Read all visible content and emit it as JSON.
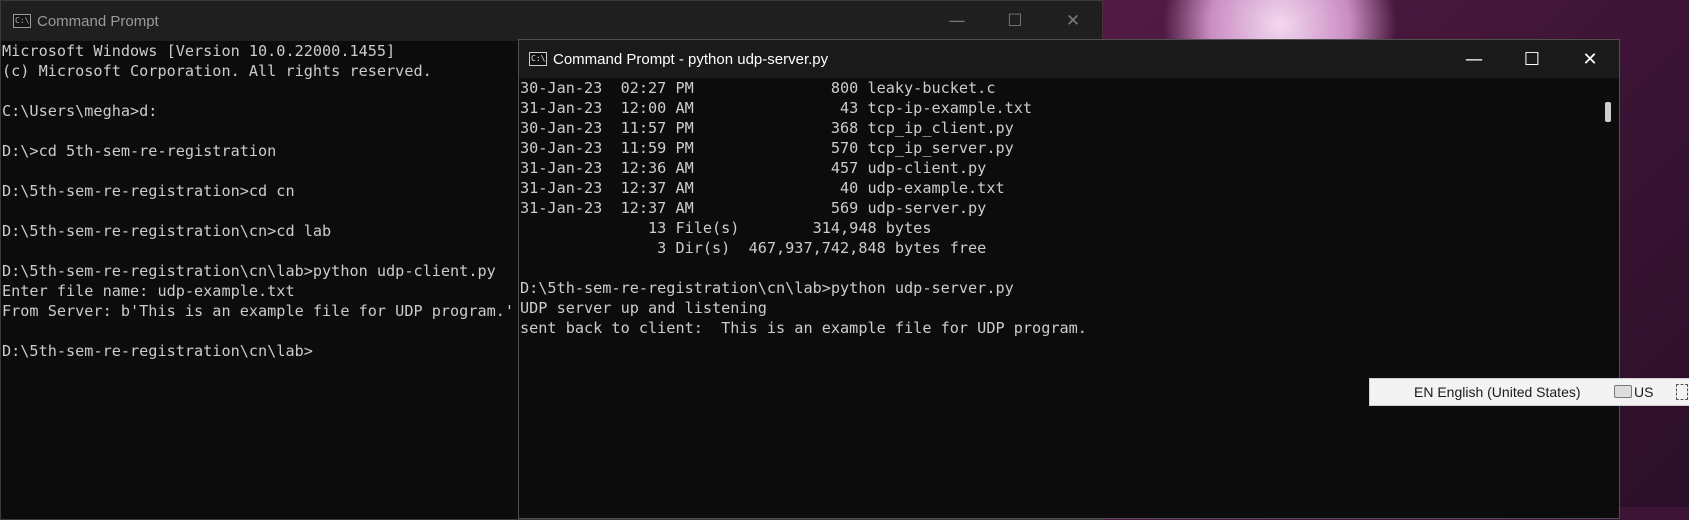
{
  "windows": {
    "left": {
      "title": "Command Prompt",
      "icon": "cmd-icon",
      "controls": {
        "minimize": "—",
        "maximize": "☐",
        "close": "✕"
      },
      "lines": [
        "Microsoft Windows [Version 10.0.22000.1455]",
        "(c) Microsoft Corporation. All rights reserved.",
        "",
        "C:\\Users\\megha>d:",
        "",
        "D:\\>cd 5th-sem-re-registration",
        "",
        "D:\\5th-sem-re-registration>cd cn",
        "",
        "D:\\5th-sem-re-registration\\cn>cd lab",
        "",
        "D:\\5th-sem-re-registration\\cn\\lab>python udp-client.py",
        "Enter file name: udp-example.txt",
        "From Server: b'This is an example file for UDP program.'",
        "",
        "D:\\5th-sem-re-registration\\cn\\lab>"
      ]
    },
    "right": {
      "title": "Command Prompt - python  udp-server.py",
      "icon": "cmd-icon",
      "controls": {
        "minimize": "—",
        "maximize": "☐",
        "close": "✕"
      },
      "lines": [
        "30-Jan-23  02:27 PM               800 leaky-bucket.c",
        "31-Jan-23  12:00 AM                43 tcp-ip-example.txt",
        "30-Jan-23  11:57 PM               368 tcp_ip_client.py",
        "30-Jan-23  11:59 PM               570 tcp_ip_server.py",
        "31-Jan-23  12:36 AM               457 udp-client.py",
        "31-Jan-23  12:37 AM                40 udp-example.txt",
        "31-Jan-23  12:37 AM               569 udp-server.py",
        "              13 File(s)        314,948 bytes",
        "               3 Dir(s)  467,937,742,848 bytes free",
        "",
        "D:\\5th-sem-re-registration\\cn\\lab>python udp-server.py",
        "UDP server up and listening",
        "sent back to client:  This is an example file for UDP program."
      ]
    }
  },
  "language_popup": {
    "language": "EN English (United States)",
    "layout": "US",
    "keyboard_icon": "keyboard-icon",
    "expand_icon": "expand-icon"
  }
}
